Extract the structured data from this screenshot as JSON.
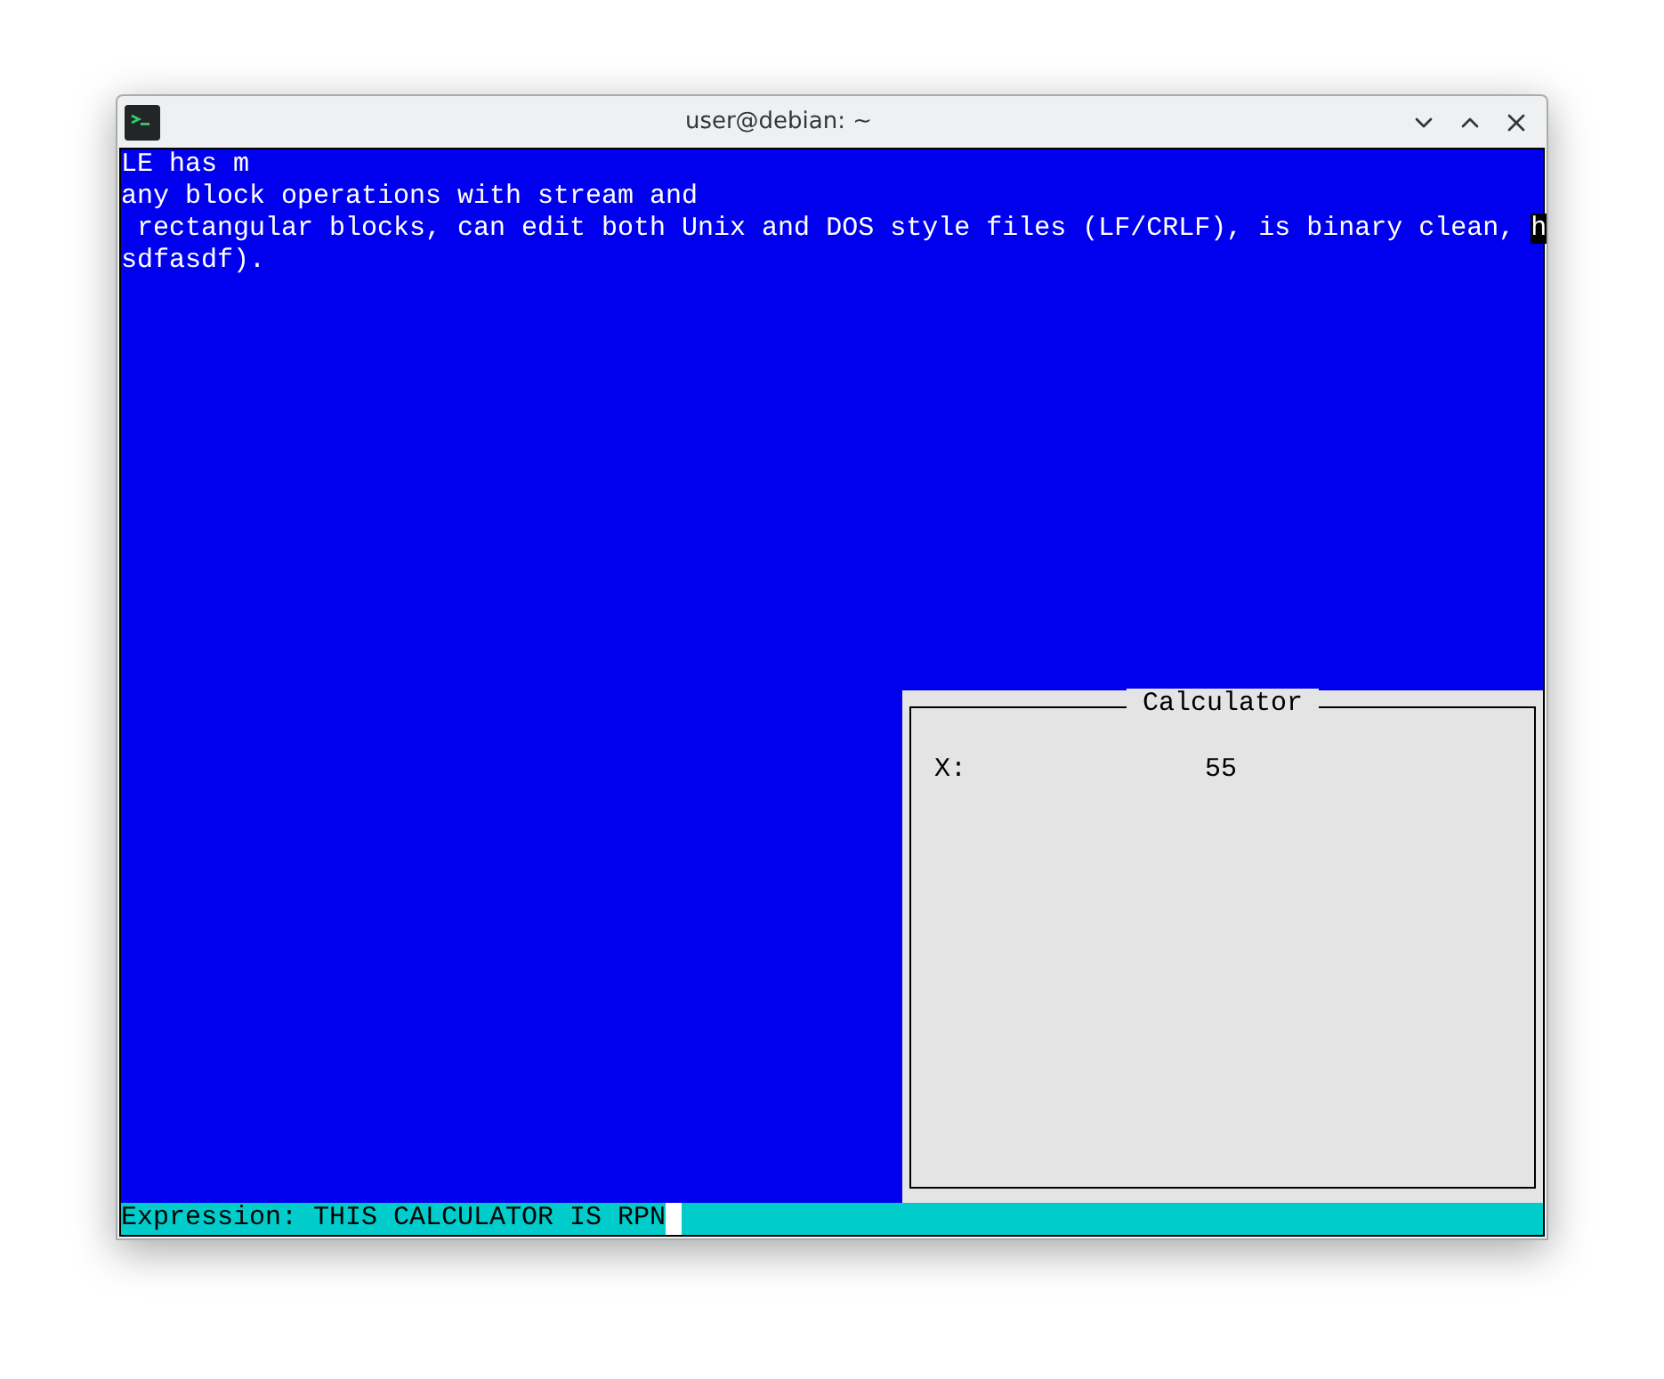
{
  "window": {
    "title": "user@debian: ~"
  },
  "editor": {
    "lines": [
      {
        "text": "LE has m"
      },
      {
        "text": "any block operations with stream and"
      },
      {
        "text": " rectangular blocks, can edit both Unix and DOS style files (LF/CRLF), is binary clean, ",
        "cursor": "h"
      },
      {
        "text": "sdfasdf)."
      }
    ]
  },
  "calculator": {
    "title": "Calculator",
    "register": "X:",
    "value": "55"
  },
  "status_bar": {
    "text": "Expression: THIS CALCULATOR IS RPN",
    "cursor": true
  }
}
